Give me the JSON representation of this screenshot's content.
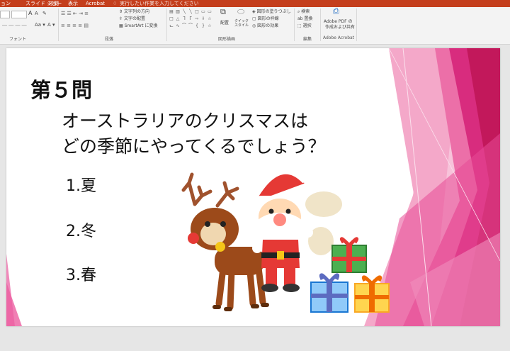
{
  "menubar": {
    "tabs": [
      "ョン",
      "スライド ショー",
      "校閲",
      "表示",
      "Acrobat"
    ],
    "tell_me_placeholder": "実行したい作業を入力してください"
  },
  "ribbon": {
    "groups": {
      "font": "フォント",
      "paragraph": "段落",
      "drawing": "図形描画",
      "editing": "編集",
      "acrobat": "Adobe Acrobat"
    },
    "paragraph": {
      "text_direction": "文字列の方向",
      "align_text": "文字の配置",
      "smartart": "SmartArt に変換"
    },
    "drawing": {
      "arrange": "配置",
      "quick_styles": "クイック スタイル",
      "shape_fill": "図形の塗りつぶし",
      "shape_outline": "図形の枠線",
      "shape_effects": "図形の効果"
    },
    "editing": {
      "find": "検索",
      "replace": "置換",
      "select": "選択"
    },
    "acrobat": {
      "create_pdf": "Adobe PDF の",
      "create_pdf_2": "作成および共有"
    }
  },
  "slide": {
    "question_number": "第５問",
    "question_line1": "オーストラリアのクリスマスは",
    "question_line2": "どの季節にやってくるでしょう？",
    "answers": [
      "1.夏",
      "2.冬",
      "3.春"
    ]
  },
  "colors": {
    "office_accent": "#c43e1c",
    "pink_dark": "#c2185b",
    "pink_mid": "#e8559a",
    "pink_light": "#f7b6d3"
  }
}
